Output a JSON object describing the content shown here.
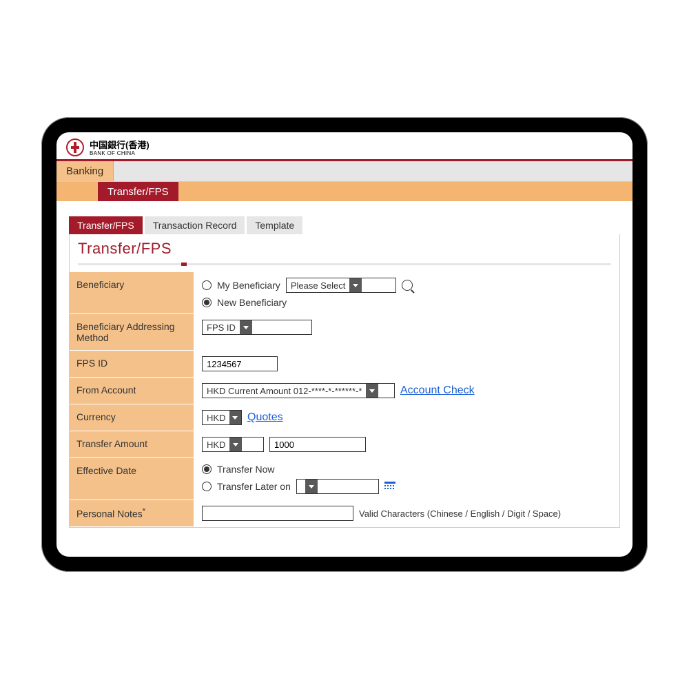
{
  "brand": {
    "chinese": "中国銀行(香港)",
    "english": "BANK OF CHINA"
  },
  "nav": {
    "top": "Banking",
    "sub": "Transfer/FPS"
  },
  "tabs": [
    {
      "label": "Transfer/FPS",
      "active": true
    },
    {
      "label": "Transaction Record",
      "active": false
    },
    {
      "label": "Template",
      "active": false
    }
  ],
  "page_title": "Transfer/FPS",
  "form": {
    "beneficiary": {
      "label": "Beneficiary",
      "opt_my": "My Beneficiary",
      "opt_new": "New Beneficiary",
      "select_placeholder": "Please Select"
    },
    "addressing": {
      "label": "Beneficiary Addressing Method",
      "value": "FPS ID"
    },
    "fps_id": {
      "label": "FPS ID",
      "value": "1234567"
    },
    "from_account": {
      "label": "From Account",
      "value": "HKD Current Amount 012-****-*-******-*",
      "link": "Account Check"
    },
    "currency": {
      "label": "Currency",
      "value": "HKD",
      "link": "Quotes"
    },
    "transfer_amount": {
      "label": "Transfer Amount",
      "currency": "HKD",
      "value": "1000"
    },
    "effective_date": {
      "label": "Effective Date",
      "opt_now": "Transfer Now",
      "opt_later": "Transfer Later on"
    },
    "personal_notes": {
      "label": "Personal Notes",
      "asterisk": "*",
      "hint": "Valid Characters (Chinese / English / Digit / Space)"
    }
  }
}
